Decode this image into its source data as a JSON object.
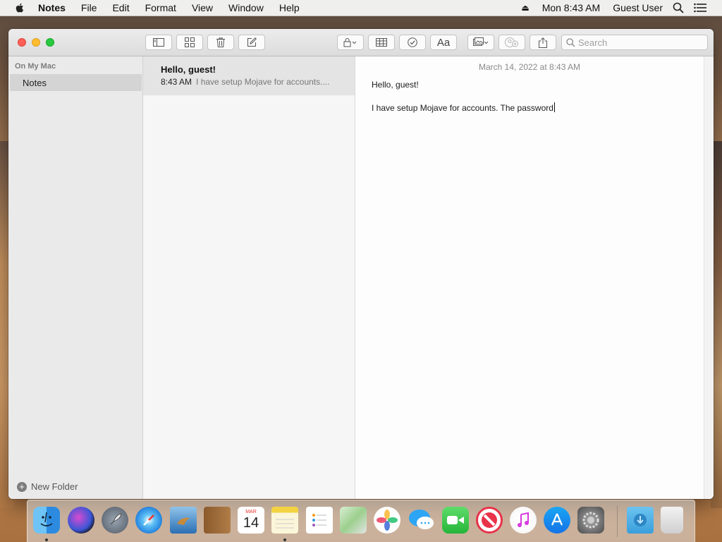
{
  "menubar": {
    "app_name": "Notes",
    "menus": [
      "File",
      "Edit",
      "Format",
      "View",
      "Window",
      "Help"
    ],
    "clock": "Mon 8:43 AM",
    "user": "Guest User",
    "eject_glyph": "⏏"
  },
  "toolbar": {
    "format_label": "Aa",
    "search_placeholder": "Search"
  },
  "sidebar": {
    "section_title": "On My Mac",
    "folders": [
      {
        "label": "Notes"
      }
    ],
    "new_folder_label": "New Folder"
  },
  "notes_list": [
    {
      "title": "Hello, guest!",
      "time": "8:43 AM",
      "preview": "I have setup Mojave for accounts...."
    }
  ],
  "editor": {
    "date": "March 14, 2022 at 8:43 AM",
    "line1": "Hello, guest!",
    "line2": "I have setup Mojave for accounts. The password"
  },
  "dock": {
    "calendar_month": "MAR",
    "calendar_day": "14",
    "apps": [
      "finder",
      "siri",
      "launchpad",
      "safari",
      "mail",
      "contacts",
      "calendar",
      "notes",
      "reminders",
      "maps",
      "photos",
      "messages",
      "facetime",
      "news",
      "itunes",
      "app-store",
      "system-preferences",
      "downloads",
      "trash"
    ]
  },
  "colors": {
    "close": "#fe5f57",
    "minimize": "#febc2e",
    "zoom": "#28c840",
    "selected_note_bg": "#e4e4e4",
    "selected_folder_bg": "#d4d4d4"
  }
}
